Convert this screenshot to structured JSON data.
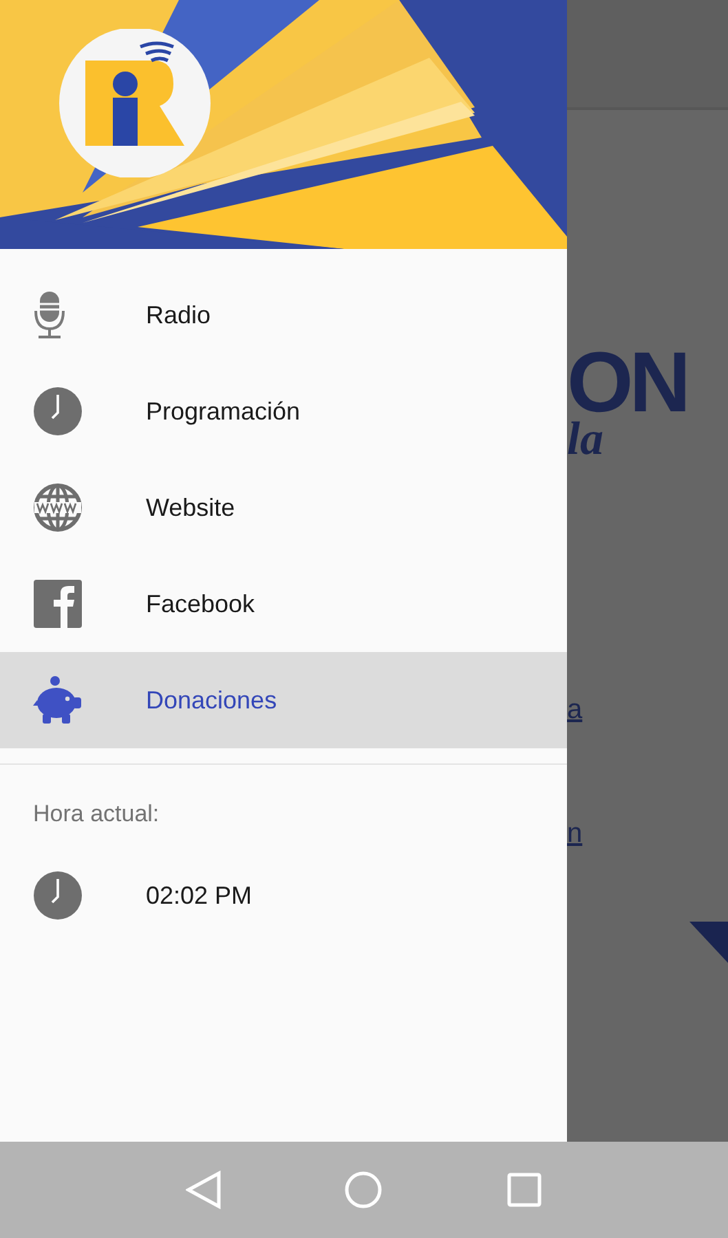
{
  "drawer": {
    "menu": [
      {
        "label": "Radio",
        "kind": "mic",
        "selected": false
      },
      {
        "label": "Programación",
        "kind": "clock",
        "selected": false
      },
      {
        "label": "Website",
        "kind": "globe",
        "selected": false
      },
      {
        "label": "Facebook",
        "kind": "facebook",
        "selected": false
      },
      {
        "label": "Donaciones",
        "kind": "piggy",
        "selected": true
      }
    ],
    "section_title": "Hora actual:",
    "current_time": "02:02 PM"
  },
  "background": {
    "heading_fragment": "ON",
    "script_fragment": "la",
    "link_fragments": [
      "a",
      "n"
    ]
  }
}
